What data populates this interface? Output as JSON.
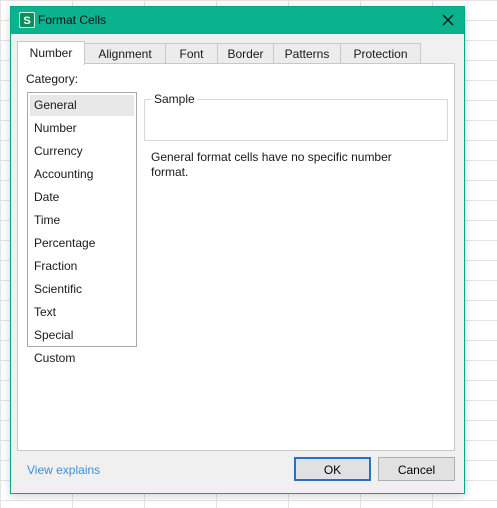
{
  "window": {
    "title": "Format Cells",
    "app_icon_letter": "S"
  },
  "tabs": [
    {
      "label": "Number",
      "active": true
    },
    {
      "label": "Alignment",
      "active": false
    },
    {
      "label": "Font",
      "active": false
    },
    {
      "label": "Border",
      "active": false
    },
    {
      "label": "Patterns",
      "active": false
    },
    {
      "label": "Protection",
      "active": false
    }
  ],
  "number_tab": {
    "category_label": "Category:",
    "categories": [
      "General",
      "Number",
      "Currency",
      "Accounting",
      "Date",
      "Time",
      "Percentage",
      "Fraction",
      "Scientific",
      "Text",
      "Special",
      "Custom"
    ],
    "selected_category": "General",
    "sample_label": "Sample",
    "description": "General format cells have no specific number format."
  },
  "footer": {
    "view_explains": "View explains",
    "ok_label": "OK",
    "cancel_label": "Cancel"
  },
  "colors": {
    "titlebar": "#0ab38d",
    "link": "#3f8fd2",
    "default_button_border": "#2a6fc4"
  }
}
